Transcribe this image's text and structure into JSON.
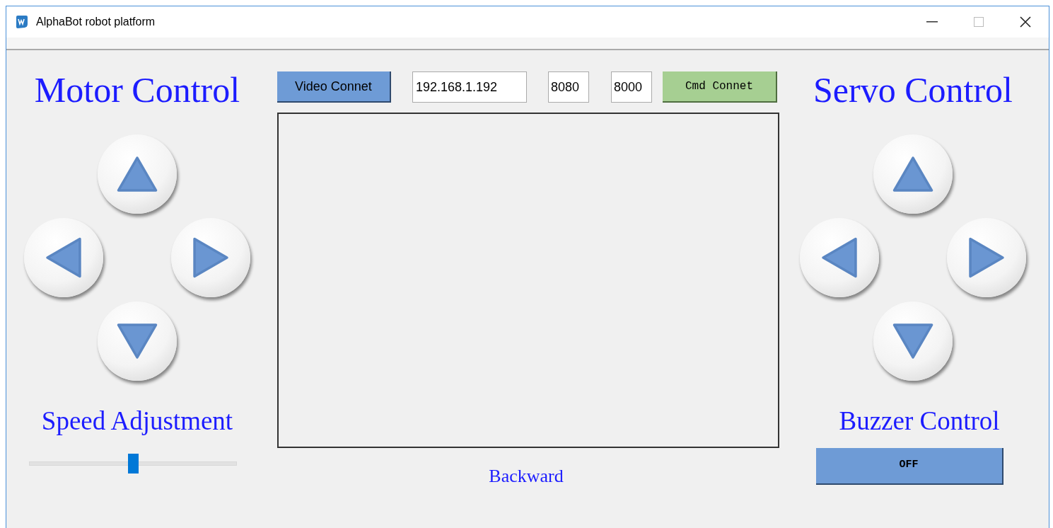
{
  "window": {
    "title": "AlphaBot robot platform"
  },
  "motor_control": {
    "title": "Motor Control"
  },
  "speed": {
    "label": "Speed Adjustment",
    "level": 0.5
  },
  "connection": {
    "video_button": "Video Connet",
    "ip": "192.168.1.192",
    "video_port": "8080",
    "cmd_port": "8000",
    "cmd_button": "Cmd Connet"
  },
  "status": "Backward",
  "servo_control": {
    "title": "Servo Control"
  },
  "buzzer": {
    "label": "Buzzer Control",
    "button": "OFF"
  }
}
